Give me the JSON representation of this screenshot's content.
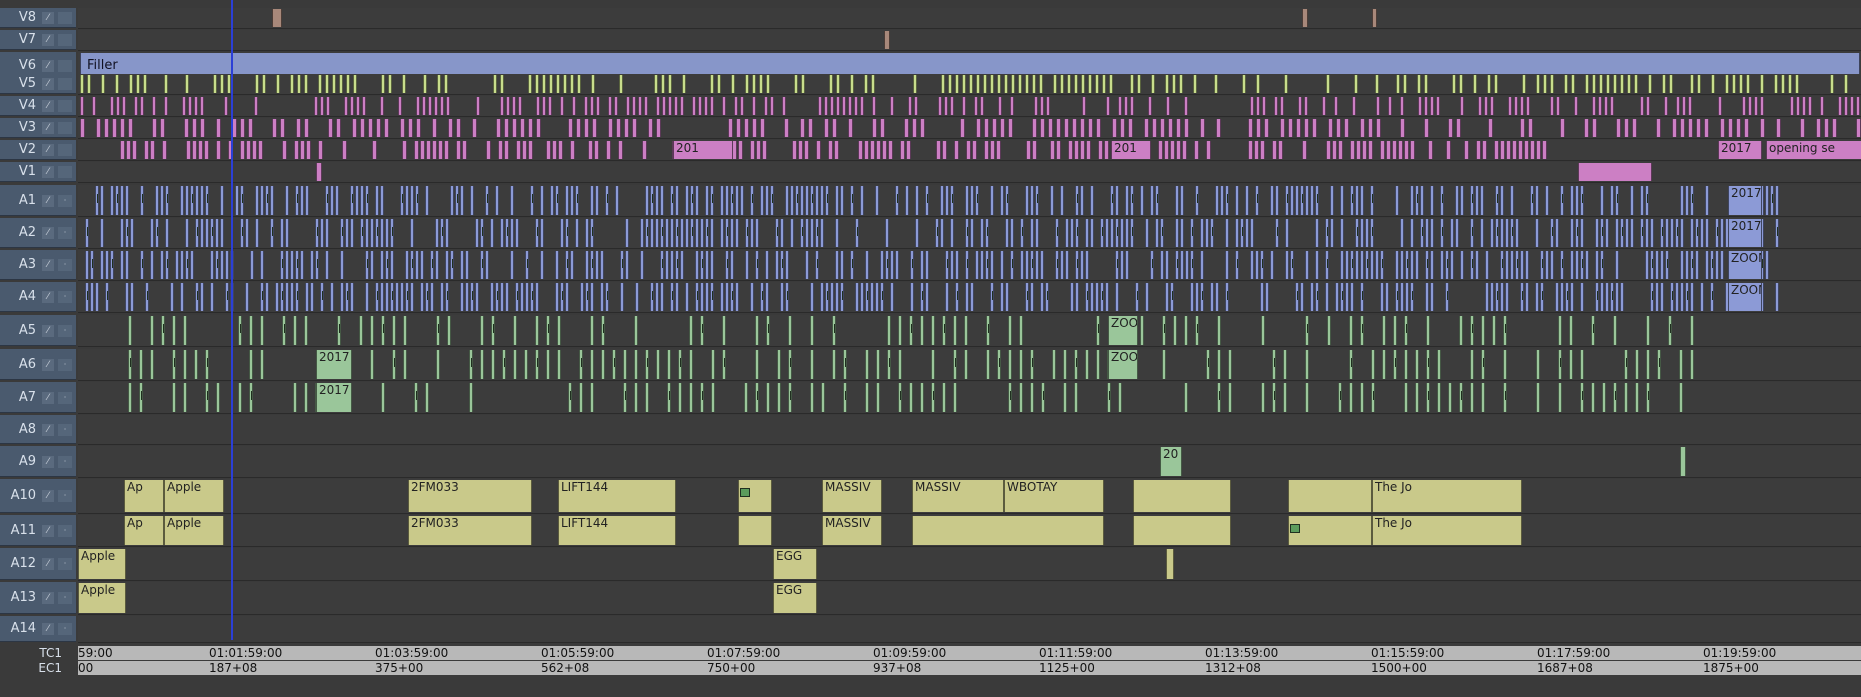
{
  "window_title": "",
  "tracks": [
    {
      "name": "V8",
      "kind": "video"
    },
    {
      "name": "V7",
      "kind": "video"
    },
    {
      "name": "V6",
      "kind": "video"
    },
    {
      "name": "V5",
      "kind": "video"
    },
    {
      "name": "V4",
      "kind": "video"
    },
    {
      "name": "V3",
      "kind": "video"
    },
    {
      "name": "V2",
      "kind": "video"
    },
    {
      "name": "V1",
      "kind": "video"
    },
    {
      "name": "A1",
      "kind": "audio"
    },
    {
      "name": "A2",
      "kind": "audio"
    },
    {
      "name": "A3",
      "kind": "audio"
    },
    {
      "name": "A4",
      "kind": "audio"
    },
    {
      "name": "A5",
      "kind": "audio"
    },
    {
      "name": "A6",
      "kind": "audio"
    },
    {
      "name": "A7",
      "kind": "audio"
    },
    {
      "name": "A8",
      "kind": "audio"
    },
    {
      "name": "A9",
      "kind": "audio"
    },
    {
      "name": "A10",
      "kind": "audio"
    },
    {
      "name": "A11",
      "kind": "audio"
    },
    {
      "name": "A12",
      "kind": "audio"
    },
    {
      "name": "A13",
      "kind": "audio"
    },
    {
      "name": "A14",
      "kind": "audio"
    }
  ],
  "labels": {
    "filler": "Filler",
    "v2_2017": "201",
    "v2_2017b": "2017",
    "v2_opening": "opening se",
    "a1_2017": "2017",
    "a2_2017": "2017",
    "a3_zoom": "ZOOM",
    "a4_zoom": "ZOOM",
    "a6_2017": "2017",
    "a7_2017": "2017",
    "a6_zoo": "ZOO",
    "a5_zoo": "ZOO",
    "a10_apple": "Apple",
    "a10_ap": "Ap",
    "a10_2fm": "2FM033",
    "a10_lift": "LIFT144",
    "a10_massiv": "MASSIV",
    "a10_wbo": "WBOTAY",
    "a10_thejo": "The Jo",
    "a11_apple": "Apple",
    "a11_2fm": "2FM033",
    "a11_lift": "LIFT144",
    "a11_massiv": "MASSIV",
    "a11_thejo": "The Jo",
    "a12_apple": "Apple",
    "a12_egg": "EGG",
    "a13_apple": "Apple",
    "a13_egg": "EGG",
    "a9_20": "20"
  },
  "timecode": {
    "tc1_label": "TC1",
    "ec1_label": "EC1",
    "tc1_marks": [
      "59:00",
      "01:01:59:00",
      "01:03:59:00",
      "01:05:59:00",
      "01:07:59:00",
      "01:09:59:00",
      "01:11:59:00",
      "01:13:59:00",
      "01:15:59:00",
      "01:17:59:00",
      "01:19:59:00"
    ],
    "ec1_marks": [
      "00",
      "187+08",
      "375+00",
      "562+08",
      "750+00",
      "937+08",
      "1125+00",
      "1312+08",
      "1500+00",
      "1687+08",
      "1875+00"
    ]
  },
  "colors": {
    "video_pink": "#cc7fc4",
    "video_lime": "#c8dd8c",
    "filler": "#8796c9",
    "audio_blue": "#8c9ad6",
    "audio_green": "#9ac69a",
    "audio_olive": "#c9c98a",
    "playhead": "#2b3fd6",
    "header": "#4a5a6e"
  }
}
